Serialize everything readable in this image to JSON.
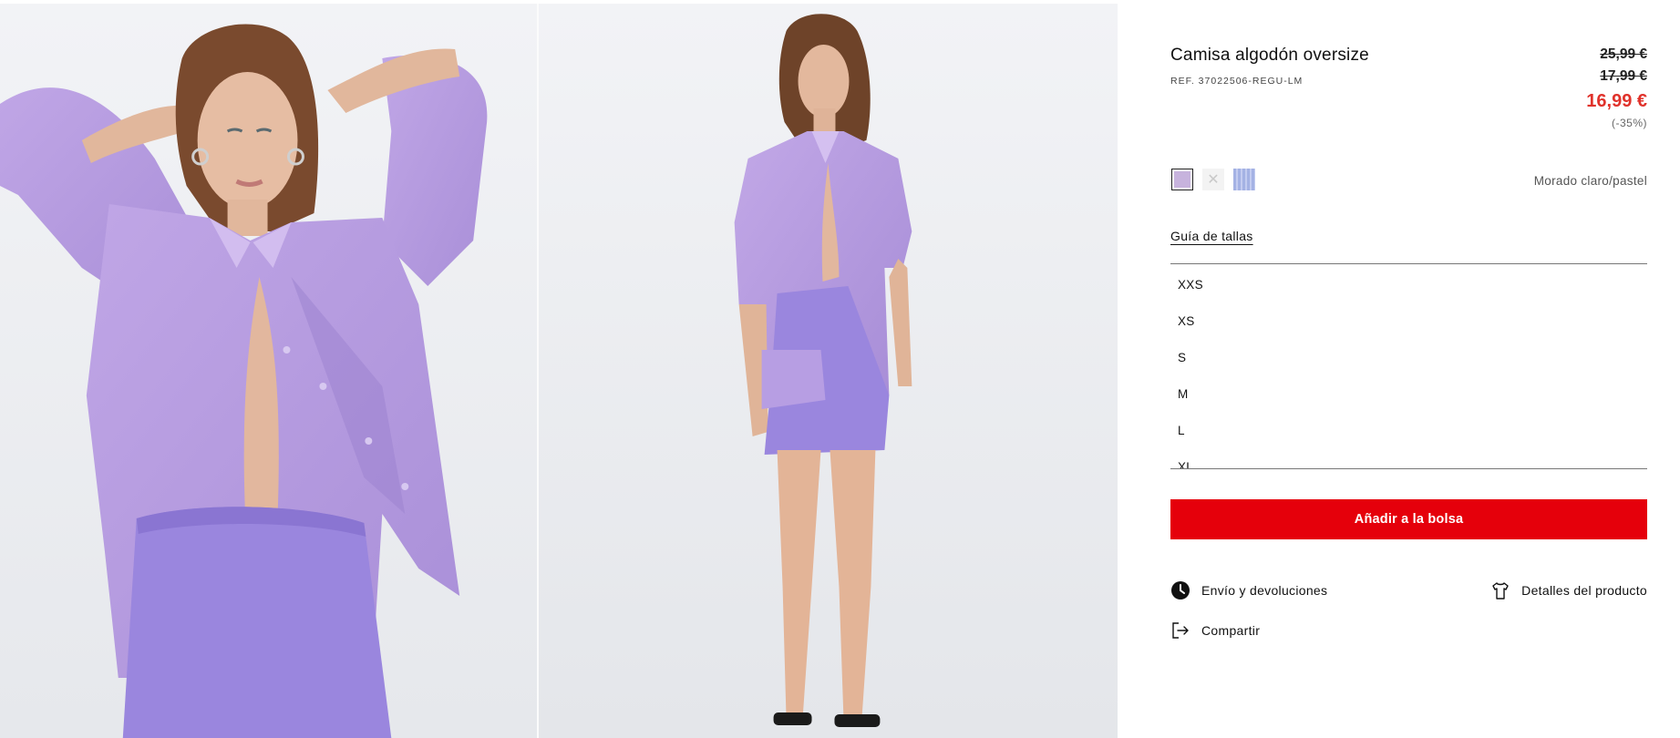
{
  "product": {
    "title": "Camisa algodón oversize",
    "ref": "REF. 37022506-REGU-LM",
    "price_original": "25,99 €",
    "price_previous": "17,99 €",
    "price_current": "16,99 €",
    "discount": "(-35%)"
  },
  "colors": {
    "selected_name": "Morado claro/pastel",
    "swatches": [
      {
        "name": "lilac",
        "hex": "#c7b3dd",
        "selected": true
      },
      {
        "name": "unavailable",
        "hex": "#f2f2f2",
        "selected": false
      },
      {
        "name": "periwinkle-stripe",
        "hex": "#a9b7e6",
        "selected": false
      }
    ]
  },
  "sizes": {
    "guide_label": "Guía de tallas",
    "items": [
      "XXS",
      "XS",
      "S",
      "M",
      "L",
      "XL"
    ]
  },
  "actions": {
    "add_to_bag": "Añadir a la bolsa",
    "shipping": "Envío y devoluciones",
    "details": "Detalles del producto",
    "share": "Compartir"
  },
  "theme": {
    "accent_red": "#e5000b",
    "sale_red": "#e0322b",
    "shirt_lilac": "#b99be0",
    "skirt_purple": "#9d86e0"
  },
  "icons": {
    "shipping": "clock-icon",
    "details": "tshirt-icon",
    "share": "share-icon"
  }
}
